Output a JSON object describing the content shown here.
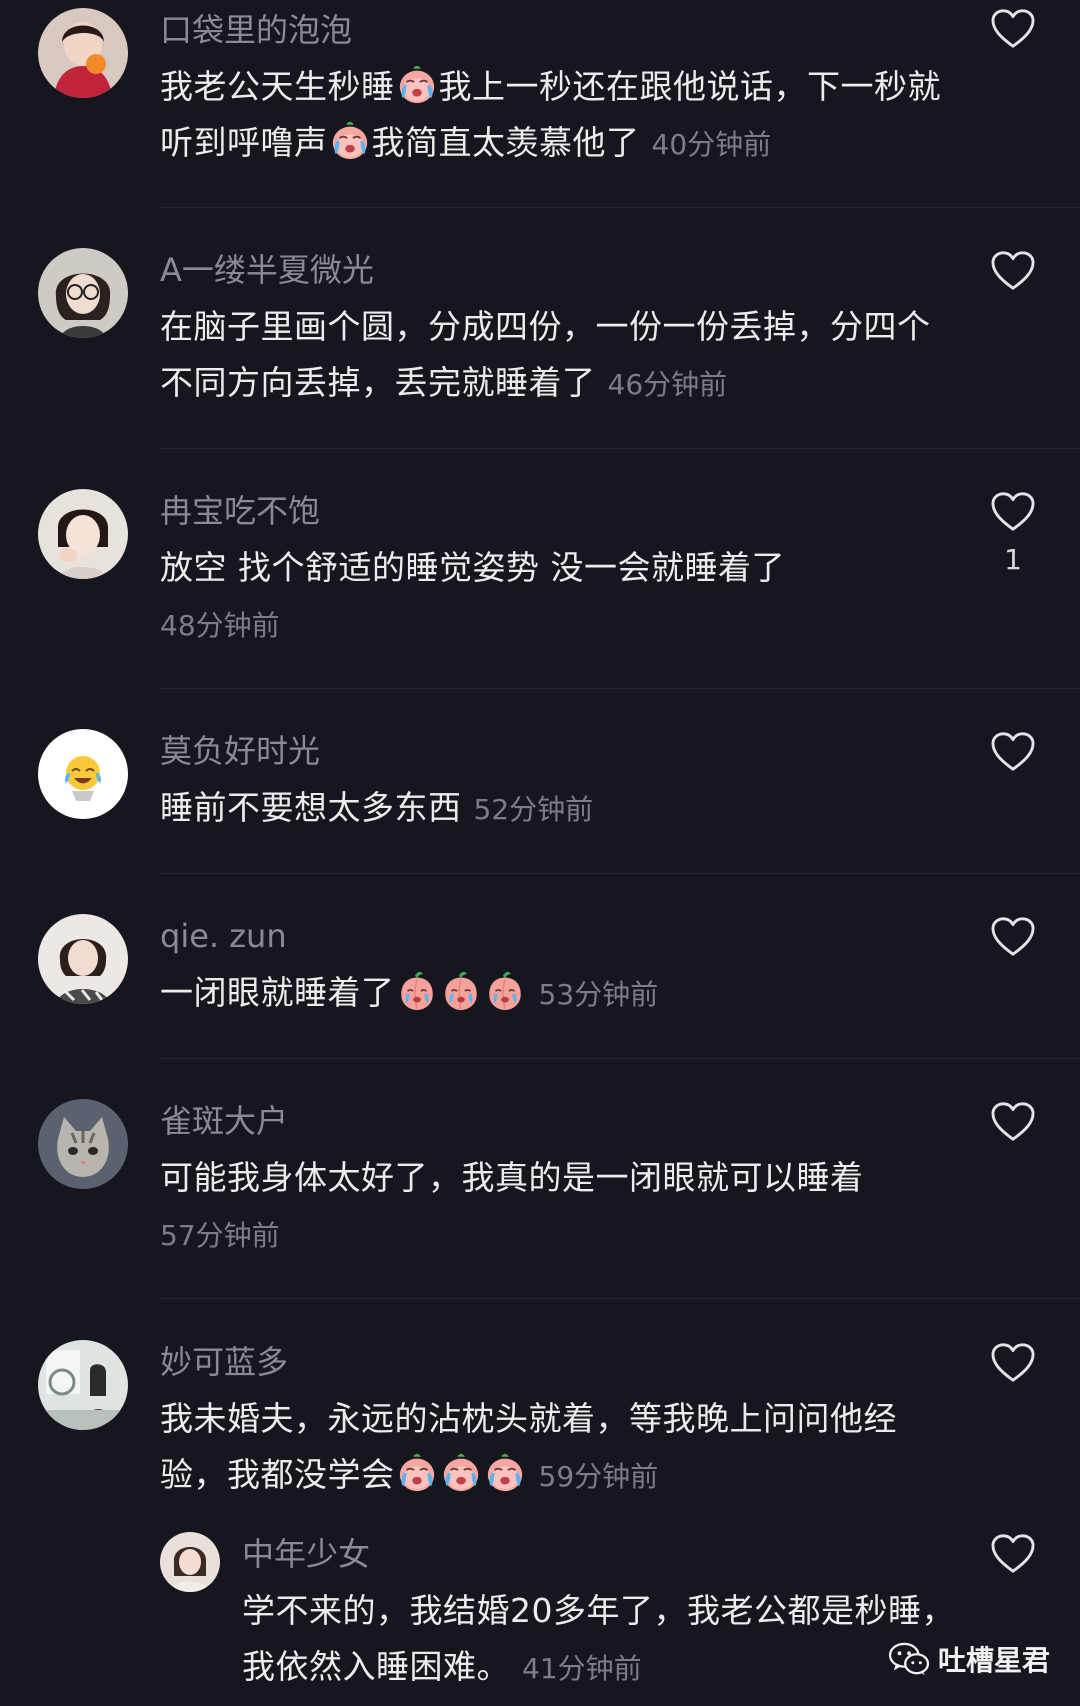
{
  "comments": [
    {
      "name": "口袋里的泡泡",
      "parts": [
        "我老公天生秒睡",
        "我上一秒还在跟他说话，下一秒就听到呼噜声",
        "我简直太羡慕他了"
      ],
      "time": "40分钟前",
      "avatar_icon": "avatar-woman-orange-icon",
      "emoji_icon": "crying-face-emoji-icon"
    },
    {
      "name": "A一缕半夏微光",
      "text": "在脑子里画个圆，分成四份，一份一份丢掉，分四个不同方向丢掉，丢完就睡着了",
      "time": "46分钟前",
      "avatar_icon": "avatar-girl-glasses-icon"
    },
    {
      "name": "冉宝吃不饱",
      "text": "放空 找个舒适的睡觉姿势 没一会就睡着了",
      "time": "48分钟前",
      "like_count": "1",
      "avatar_icon": "avatar-girl-thinking-icon"
    },
    {
      "name": "莫负好时光",
      "text": "睡前不要想太多东西",
      "time": "52分钟前",
      "avatar_icon": "avatar-laughing-emoji-icon"
    },
    {
      "name": "qie. zun",
      "text": "一闭眼就睡着了",
      "time": "53分钟前",
      "avatar_icon": "avatar-woman-portrait-icon",
      "emoji_icon": "peach-crying-emoji-icon"
    },
    {
      "name": "雀斑大户",
      "text": "可能我身体太好了，我真的是一闭眼就可以睡着",
      "time": "57分钟前",
      "avatar_icon": "avatar-cat-icon"
    },
    {
      "name": "妙可蓝多",
      "text": "我未婚夫，永远的沾枕头就着，等我晚上问问他经验，我都没学会",
      "time": "59分钟前",
      "avatar_icon": "avatar-room-photo-icon",
      "emoji_icon": "crying-face-emoji-icon"
    }
  ],
  "reply": {
    "name": "中年少女",
    "text": "学不来的，我结婚20多年了，我老公都是秒睡，我依然入睡困难。",
    "time": "41分钟前",
    "avatar_icon": "avatar-woman-small-icon"
  },
  "watermark": {
    "text": "吐槽星君",
    "icon": "wechat-icon"
  },
  "colors": {
    "background": "#16161e",
    "username": "#8a8a92",
    "comment_text": "#ececec",
    "timestamp": "#7d7d85",
    "divider": "#26262f"
  }
}
